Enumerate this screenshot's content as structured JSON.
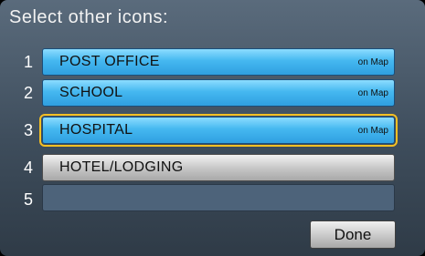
{
  "title": "Select other icons:",
  "rows": [
    {
      "number": "1",
      "label": "POST OFFICE",
      "tag": "on Map"
    },
    {
      "number": "2",
      "label": "SCHOOL",
      "tag": "on Map"
    },
    {
      "number": "3",
      "label": "HOSPITAL",
      "tag": "on Map"
    },
    {
      "number": "4",
      "label": "HOTEL/LODGING",
      "tag": ""
    },
    {
      "number": "5",
      "label": "",
      "tag": ""
    }
  ],
  "done_label": "Done",
  "colors": {
    "row_blue": "#45b8f0",
    "row_gray": "#c4c4c4",
    "row_empty": "#4d637a",
    "selection_outline": "#f5c023",
    "background": "#4a5a6b"
  }
}
